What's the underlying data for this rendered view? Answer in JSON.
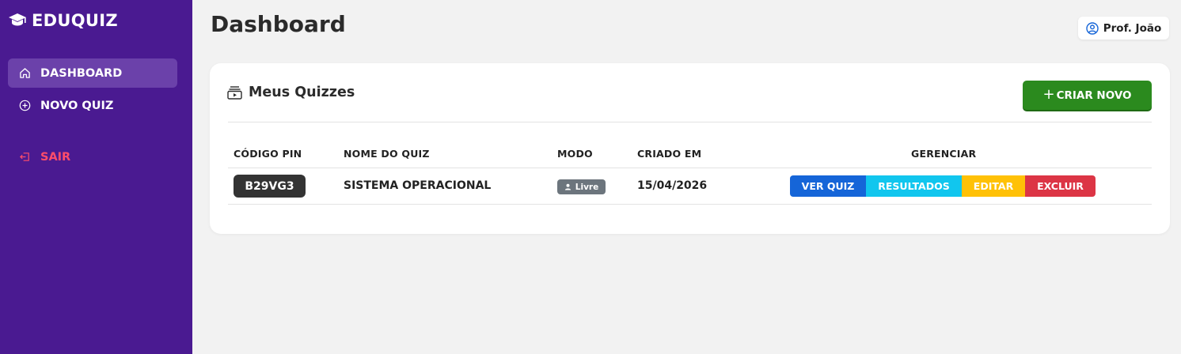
{
  "brand": {
    "name": "EDUQUIZ"
  },
  "sidebar": {
    "items": [
      {
        "label": "DASHBOARD",
        "icon": "home-icon",
        "active": true
      },
      {
        "label": "NOVO QUIZ",
        "icon": "plus-circle-icon",
        "active": false
      },
      {
        "label": "SAIR",
        "icon": "logout-icon",
        "active": false
      }
    ]
  },
  "header": {
    "title": "Dashboard",
    "user": "Prof. João"
  },
  "card": {
    "title": "Meus Quizzes",
    "create_label": "CRIAR NOVO",
    "create_plus": "+"
  },
  "table": {
    "headers": [
      "CÓDIGO PIN",
      "NOME DO QUIZ",
      "MODO",
      "CRIADO EM",
      "GERENCIAR"
    ],
    "rows": [
      {
        "pin": "B29VG3",
        "name": "SISTEMA OPERACIONAL",
        "mode": "Livre",
        "created": "15/04/2026",
        "actions": {
          "view": "VER QUIZ",
          "results": "RESULTADOS",
          "edit": "EDITAR",
          "delete": "EXCLUIR"
        }
      }
    ]
  },
  "colors": {
    "sidebar": "#4a1a91",
    "sidebar_active": "#6b41aa",
    "logout": "#ff4d6a",
    "create_button": "#2b8a1e",
    "view": "#1565d8",
    "results": "#11c6ee",
    "edit": "#ffc107",
    "delete": "#dc3545",
    "pin_badge": "#333333",
    "mode_badge": "#6c757d"
  }
}
